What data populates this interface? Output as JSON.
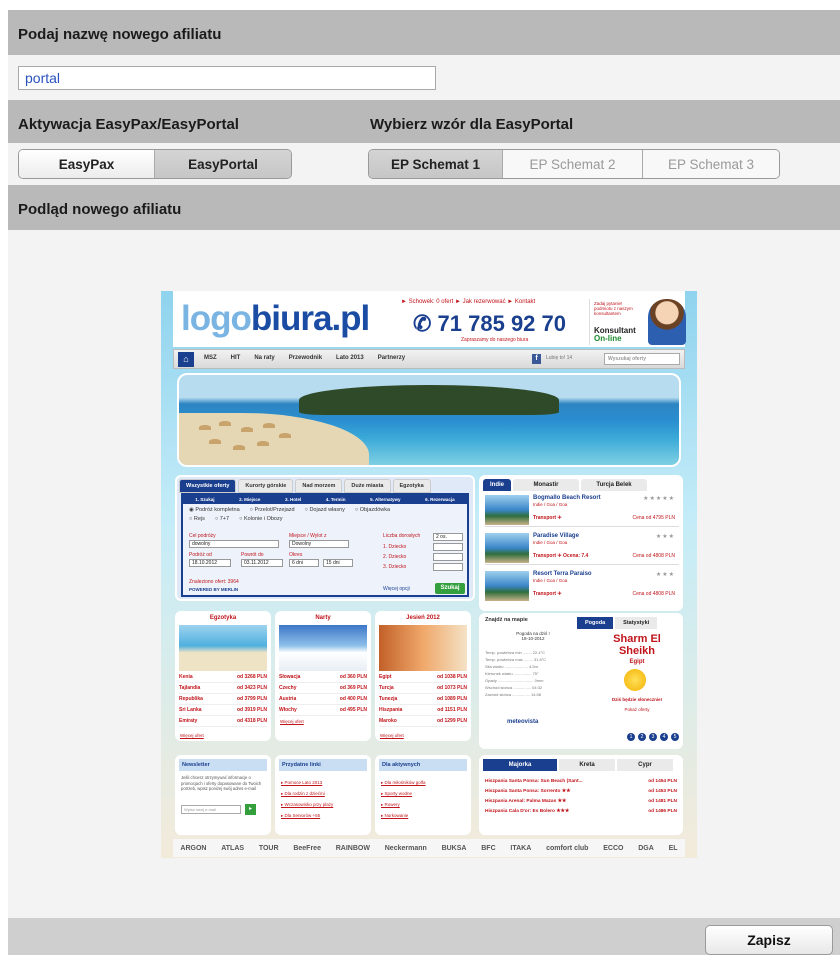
{
  "sections": {
    "affiliate_name_heading": "Podaj nazwę nowego afiliatu",
    "activation_heading": "Aktywacja EasyPax/EasyPortal",
    "template_heading": "Wybierz wzór dla EasyPortal",
    "preview_heading": "Podląd nowego afiliatu"
  },
  "affiliate_name": {
    "value": "portal"
  },
  "activation": {
    "options": [
      "EasyPax",
      "EasyPortal"
    ],
    "selected": "EasyPortal"
  },
  "templates": {
    "options": [
      "EP Schemat 1",
      "EP Schemat 2",
      "EP Schemat 3"
    ],
    "selected": "EP Schemat 1"
  },
  "footer": {
    "save_label": "Zapisz"
  },
  "preview": {
    "logo_part1": "logo",
    "logo_part2": "biura.pl",
    "top_links": "► Schowek: 0 ofert   ► Jak rezerwować   ► Kontakt",
    "phone": "✆ 71 785 92 70",
    "phone_sub": "Zapraszamy do naszego biura",
    "hotline_small": "Zadaj pytanie! podmiotu z naszym konsultantem",
    "hotline_label": "Konsultant",
    "hotline_online": "On-line",
    "nav": [
      "MSZ",
      "HIT",
      "Na raty",
      "Przewodnik",
      "Lato 2013",
      "Partnerzy"
    ],
    "nav_search_placeholder": "Wyszukaj oferty",
    "nav_like": "Lubię to!  14",
    "search_tabs": [
      "Wszystkie oferty",
      "Kurorty górskie",
      "Nad morzem",
      "Duże miasta",
      "Egzotyka"
    ],
    "search_steps": [
      "1. Szukaj",
      "2. Miejsce",
      "3. Hotel",
      "4. Termin",
      "5. Alternatywy",
      "6. Rezerwacja"
    ],
    "search_radios_1": [
      "Podróż kompletna",
      "Przelot/Przejazd",
      "Dojazd własny",
      "Objazdówka"
    ],
    "search_radios_2": [
      "Rejs",
      "7+7",
      "Kolonie i Obozy"
    ],
    "search_labels": {
      "destination": "Cel podróży",
      "departure": "Miejsce / Wylot z",
      "date_from": "Podróż od",
      "date_to": "Powrót do",
      "duration": "Okres",
      "adults": "Liczba dorosłych",
      "child1": "1. Dziecko",
      "child2": "2. Dziecko",
      "child3": "3. Dziecko"
    },
    "search_values": {
      "destination": "dowolny",
      "departure": "Dowolny",
      "date_from": "18.10.2012",
      "date_to": "03.11.2012",
      "duration_from": "6 dni",
      "duration_to": "15 dni",
      "adults": "2 os."
    },
    "search_found": "Znaleziono ofert: 3964",
    "search_powered": "POWERED BY MERLIN",
    "search_more": "Więcej opcji",
    "search_button": "Szukaj",
    "hotel_tabs": [
      "Indie",
      "Monastir",
      "Turcja Belek"
    ],
    "hotels": [
      {
        "name": "Bogmallo Beach Resort",
        "loc": "Indie / Goa / Goa",
        "transport": "Transport ✈",
        "price": "Cena od 4795 PLN",
        "stars": "★★★★★"
      },
      {
        "name": "Paradise Village",
        "loc": "Indie / Goa / Goa",
        "transport": "Transport ✈  Ocena: 7.4",
        "price": "Cena od 4808 PLN",
        "stars": "★★★"
      },
      {
        "name": "Resort Terra Paraiso",
        "loc": "Indie / Goa / Goa",
        "transport": "Transport ✈",
        "price": "Cena od 4808 PLN",
        "stars": "★★★"
      }
    ],
    "col1": {
      "title": "Egzotyka",
      "rows": [
        [
          "Kenia",
          "od 3268 PLN"
        ],
        [
          "Tajlandia",
          "od 3423 PLN"
        ],
        [
          "Republika",
          "od 3799 PLN"
        ],
        [
          "Sri Lanka",
          "od 3919 PLN"
        ],
        [
          "Emiraty",
          "od 4318 PLN"
        ]
      ],
      "more": "Więcej ofert"
    },
    "col2": {
      "title": "Narty",
      "rows": [
        [
          "Słowacja",
          "od 360 PLN"
        ],
        [
          "Czechy",
          "od 369 PLN"
        ],
        [
          "Austria",
          "od 400 PLN"
        ],
        [
          "Włochy",
          "od 495 PLN"
        ]
      ],
      "more": "Więcej ofert"
    },
    "col3": {
      "title": "Jesień 2012",
      "rows": [
        [
          "Egipt",
          "od 1038 PLN"
        ],
        [
          "Turcja",
          "od 1073 PLN"
        ],
        [
          "Tunezja",
          "od 1089 PLN"
        ],
        [
          "Hiszpania",
          "od 1151 PLN"
        ],
        [
          "Maroko",
          "od 1299 PLN"
        ]
      ],
      "more": "Więcej ofert"
    },
    "weather": {
      "map_tab": "Znajdź na mapie",
      "tabs": [
        "Pogoda",
        "Statystyki"
      ],
      "today": "Pogoda na dziś !",
      "date": "18-10-2012",
      "info": [
        "Temp. powietrza min ........ 22.4°C",
        "Temp. powietrza max ........ 31.8°C",
        "Siła wiatru ..................... 4.5m",
        "Kierunek wiatru ................ 75°",
        "Opady ................................ 0mm",
        "Wschód słońca ................ 04:32",
        "Zachód słońca ................ 14:08"
      ],
      "city": "Sharm El Sheikh",
      "country": "Egipt",
      "msg": "Dziś będzie słonecznie!",
      "offers_link": "Pokaż oferty",
      "provider": "meteovista",
      "pages": [
        "1",
        "2",
        "3",
        "4",
        "5"
      ]
    },
    "newsletter": {
      "title": "Newsletter",
      "text": "Jeśli chcesz otrzymywać informacje o promocjach i oferty dopasowane do Twoich potrzeb, wpisz poniżej swój adres e-mail",
      "placeholder": "Wpisz swój e-mail",
      "button": "▸"
    },
    "links": {
      "title": "Przydatne linki",
      "items": [
        "Pomoce Lato 2013",
        "Dla rodzin z dziećmi",
        "Wczasowisko przy plaży",
        "Dla Seniorów +55"
      ]
    },
    "active": {
      "title": "Dla aktywnych",
      "items": [
        "Dla miłośników golfa",
        "Sporty wodne",
        "Rowery",
        "Nurkowanie"
      ]
    },
    "offer_tabs": [
      "Majorka",
      "Kreta",
      "Cypr"
    ],
    "offers": [
      [
        "Hiszpania Santa Ponsa: Sun Beach (Sant...",
        "od 1454 PLN"
      ],
      [
        "Hiszpania Santa Ponsa: Sorrento ★★",
        "od 1453 PLN"
      ],
      [
        "Hiszpania Arenal: Palma Mazas ★★",
        "od 1481 PLN"
      ],
      [
        "Hiszpania Cala D'or: Es Bolero ★★★",
        "od 1486 PLN"
      ]
    ],
    "partner_logos": [
      "ARGON",
      "ATLAS",
      "TOUR",
      "BeeFree",
      "RAINBOW",
      "Neckermann",
      "BUKSA",
      "BFC",
      "ITAKA",
      "comfort club",
      "ECCO",
      "DGA",
      "EL"
    ]
  }
}
